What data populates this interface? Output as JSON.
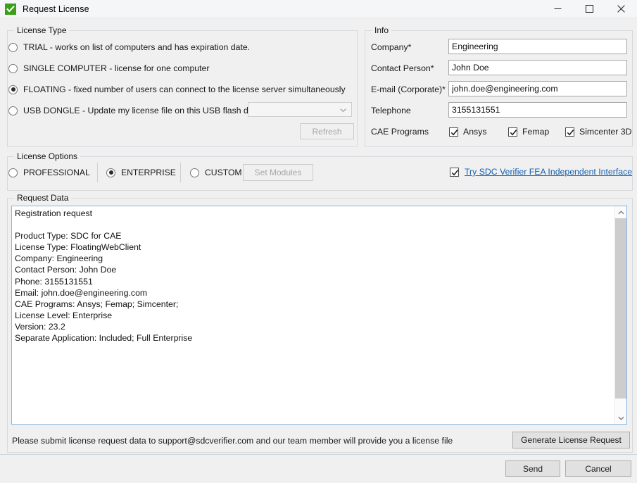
{
  "window": {
    "title": "Request License",
    "app_icon": "checkmark-icon",
    "controls": {
      "minimize": "minimize-icon",
      "maximize": "maximize-icon",
      "close": "close-icon"
    }
  },
  "license_type": {
    "legend": "License Type",
    "options": [
      {
        "label": "TRIAL -  works on list of computers and has expiration date.",
        "checked": false
      },
      {
        "label": "SINGLE COMPUTER - license for one computer",
        "checked": false
      },
      {
        "label": "FLOATING - fixed number of users can connect to the license server simultaneously",
        "checked": true
      },
      {
        "label": "USB DONGLE - Update my license file on this USB flash drive:",
        "checked": false
      }
    ],
    "usb_drive_value": "",
    "usb_drive_placeholder": "",
    "refresh_label": "Refresh",
    "refresh_disabled": true
  },
  "info": {
    "legend": "Info",
    "fields": [
      {
        "label": "Company*",
        "value": "Engineering"
      },
      {
        "label": "Contact Person*",
        "value": "John Doe"
      },
      {
        "label": "E-mail (Corporate)*",
        "value": "john.doe@engineering.com"
      },
      {
        "label": "Telephone",
        "value": "3155131551"
      }
    ],
    "cae_label": "CAE Programs",
    "cae_programs": [
      {
        "label": "Ansys",
        "checked": true
      },
      {
        "label": "Femap",
        "checked": true
      },
      {
        "label": "Simcenter 3D",
        "checked": true
      }
    ]
  },
  "license_options": {
    "legend": "License Options",
    "options": [
      {
        "label": "PROFESSIONAL",
        "checked": false
      },
      {
        "label": "ENTERPRISE",
        "checked": true
      },
      {
        "label": "CUSTOM",
        "checked": false
      }
    ],
    "set_modules_label": "Set Modules",
    "set_modules_disabled": true,
    "try_checkbox_checked": true,
    "try_link_label": "Try SDC Verifier FEA Independent Interface",
    "link_color": "#1560b0"
  },
  "request_data": {
    "legend": "Request Data",
    "text": "Registration request\n\nProduct Type: SDC for CAE\nLicense Type: FloatingWebClient\nCompany: Engineering\nContact Person: John Doe\nPhone: 3155131551\nEmail: john.doe@engineering.com\nCAE Programs: Ansys; Femap; Simcenter;\nLicense Level: Enterprise\nVersion: 23.2\nSeparate Application: Included; Full Enterprise"
  },
  "footer": {
    "note": "Please submit license request data to support@sdcverifier.com and our team member will provide you a license file",
    "generate_label": "Generate License Request",
    "send_label": "Send",
    "cancel_label": "Cancel"
  }
}
